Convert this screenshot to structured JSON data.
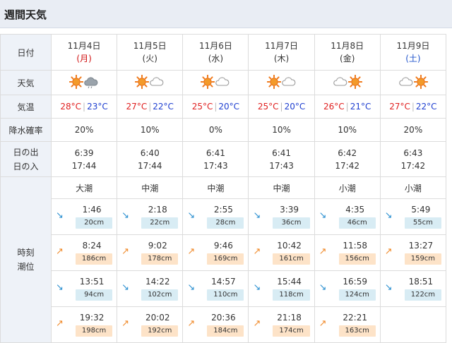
{
  "header": {
    "title": "週間天気"
  },
  "labels": {
    "date": "日付",
    "weather": "天気",
    "temp": "気温",
    "rain": "降水確率",
    "sunrise": "日の出",
    "sunset": "日の入",
    "time": "時刻",
    "tide_level": "潮位"
  },
  "colors": {
    "high": "#e02020",
    "low": "#2040d0",
    "saturday": "#2255cc",
    "sunday": "#d01010",
    "ebb_bg": "#d8ecf4",
    "flood_bg": "#fde3c8"
  },
  "temp_separator": "|",
  "days": [
    {
      "date": "11月4日",
      "weekday": "(月)",
      "weekday_style": "sun",
      "weather": [
        "sun-icon",
        "rain-cloud-icon"
      ],
      "high": "28°C",
      "low": "23°C",
      "rain": "20%",
      "sunrise": "6:39",
      "sunset": "17:44",
      "tide_name": "大潮",
      "tides": [
        {
          "dir": "ebb",
          "time": "1:46",
          "level": "20cm"
        },
        {
          "dir": "flood",
          "time": "8:24",
          "level": "186cm"
        },
        {
          "dir": "ebb",
          "time": "13:51",
          "level": "94cm"
        },
        {
          "dir": "flood",
          "time": "19:32",
          "level": "198cm"
        }
      ]
    },
    {
      "date": "11月5日",
      "weekday": "(火)",
      "weekday_style": "normal",
      "weather": [
        "sun-icon",
        "cloud-icon"
      ],
      "high": "27°C",
      "low": "22°C",
      "rain": "10%",
      "sunrise": "6:40",
      "sunset": "17:44",
      "tide_name": "中潮",
      "tides": [
        {
          "dir": "ebb",
          "time": "2:18",
          "level": "22cm"
        },
        {
          "dir": "flood",
          "time": "9:02",
          "level": "178cm"
        },
        {
          "dir": "ebb",
          "time": "14:22",
          "level": "102cm"
        },
        {
          "dir": "flood",
          "time": "20:02",
          "level": "192cm"
        }
      ]
    },
    {
      "date": "11月6日",
      "weekday": "(水)",
      "weekday_style": "normal",
      "weather": [
        "sun-icon",
        "cloud-icon"
      ],
      "high": "25°C",
      "low": "20°C",
      "rain": "0%",
      "sunrise": "6:41",
      "sunset": "17:43",
      "tide_name": "中潮",
      "tides": [
        {
          "dir": "ebb",
          "time": "2:55",
          "level": "28cm"
        },
        {
          "dir": "flood",
          "time": "9:46",
          "level": "169cm"
        },
        {
          "dir": "ebb",
          "time": "14:57",
          "level": "110cm"
        },
        {
          "dir": "flood",
          "time": "20:36",
          "level": "184cm"
        }
      ]
    },
    {
      "date": "11月7日",
      "weekday": "(木)",
      "weekday_style": "normal",
      "weather": [
        "sun-icon",
        "cloud-icon"
      ],
      "high": "25°C",
      "low": "20°C",
      "rain": "10%",
      "sunrise": "6:41",
      "sunset": "17:43",
      "tide_name": "中潮",
      "tides": [
        {
          "dir": "ebb",
          "time": "3:39",
          "level": "36cm"
        },
        {
          "dir": "flood",
          "time": "10:42",
          "level": "161cm"
        },
        {
          "dir": "ebb",
          "time": "15:44",
          "level": "118cm"
        },
        {
          "dir": "flood",
          "time": "21:18",
          "level": "174cm"
        }
      ]
    },
    {
      "date": "11月8日",
      "weekday": "(金)",
      "weekday_style": "normal",
      "weather": [
        "cloud-icon",
        "sun-icon"
      ],
      "high": "26°C",
      "low": "21°C",
      "rain": "10%",
      "sunrise": "6:42",
      "sunset": "17:42",
      "tide_name": "小潮",
      "tides": [
        {
          "dir": "ebb",
          "time": "4:35",
          "level": "46cm"
        },
        {
          "dir": "flood",
          "time": "11:58",
          "level": "156cm"
        },
        {
          "dir": "ebb",
          "time": "16:59",
          "level": "124cm"
        },
        {
          "dir": "flood",
          "time": "22:21",
          "level": "163cm"
        }
      ]
    },
    {
      "date": "11月9日",
      "weekday": "(土)",
      "weekday_style": "sat",
      "weather": [
        "cloud-icon",
        "sun-icon"
      ],
      "high": "27°C",
      "low": "22°C",
      "rain": "20%",
      "sunrise": "6:43",
      "sunset": "17:42",
      "tide_name": "小潮",
      "tides": [
        {
          "dir": "flood",
          "time": "13:27",
          "level": "159cm",
          "slot": 1
        },
        {
          "dir": "ebb",
          "time": "5:49",
          "level": "55cm",
          "slot": 0
        },
        {
          "dir": "ebb",
          "time": "18:51",
          "level": "122cm",
          "slot": 2
        }
      ]
    }
  ]
}
